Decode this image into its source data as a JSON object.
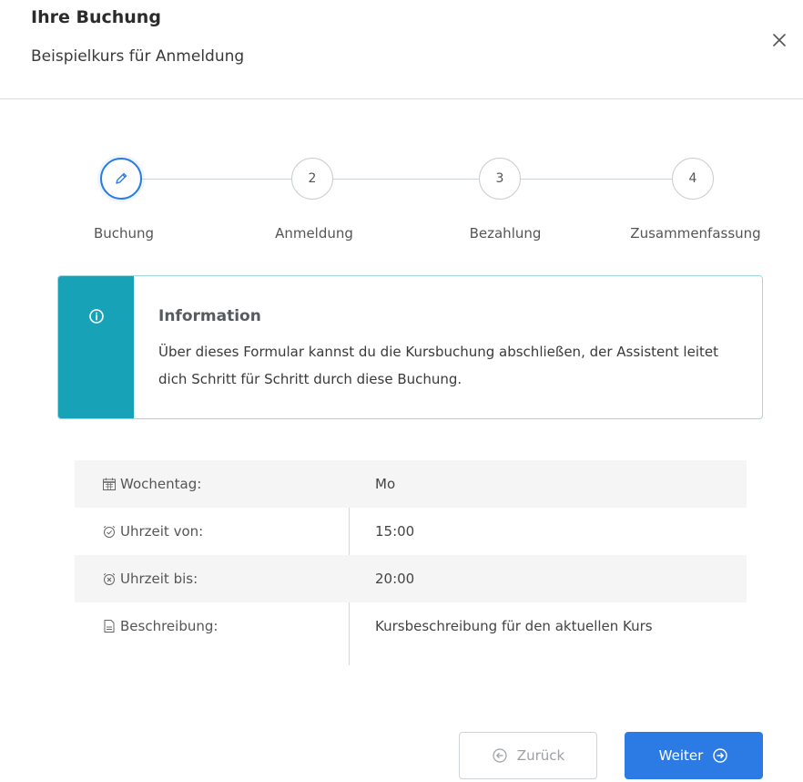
{
  "header": {
    "title": "Ihre Buchung",
    "subtitle": "Beispielkurs für Anmeldung",
    "close_icon": "close-icon"
  },
  "stepper": {
    "steps": [
      {
        "number": "",
        "label": "Buchung",
        "state": "active",
        "icon": "pencil-icon"
      },
      {
        "number": "2",
        "label": "Anmeldung",
        "state": "pending"
      },
      {
        "number": "3",
        "label": "Bezahlung",
        "state": "pending"
      },
      {
        "number": "4",
        "label": "Zusammenfassung",
        "state": "pending"
      }
    ]
  },
  "info": {
    "icon": "info-circle-icon",
    "title": "Information",
    "text": "Über dieses Formular kannst du die Kursbuchung abschließen, der Assistent leitet dich Schritt für Schritt durch diese Buchung."
  },
  "details": [
    {
      "icon": "calendar-icon",
      "label": "Wochentag:",
      "value": "Mo"
    },
    {
      "icon": "clock-check-icon",
      "label": "Uhrzeit von:",
      "value": "15:00"
    },
    {
      "icon": "clock-x-icon",
      "label": "Uhrzeit bis:",
      "value": "20:00"
    },
    {
      "icon": "document-icon",
      "label": "Beschreibung:",
      "value": "Kursbeschreibung für den aktuellen Kurs"
    }
  ],
  "footer": {
    "back_label": "Zurück",
    "next_label": "Weiter"
  },
  "colors": {
    "primary": "#2c7be5",
    "info": "#17a2b8",
    "info_border": "#9fd7e1"
  }
}
